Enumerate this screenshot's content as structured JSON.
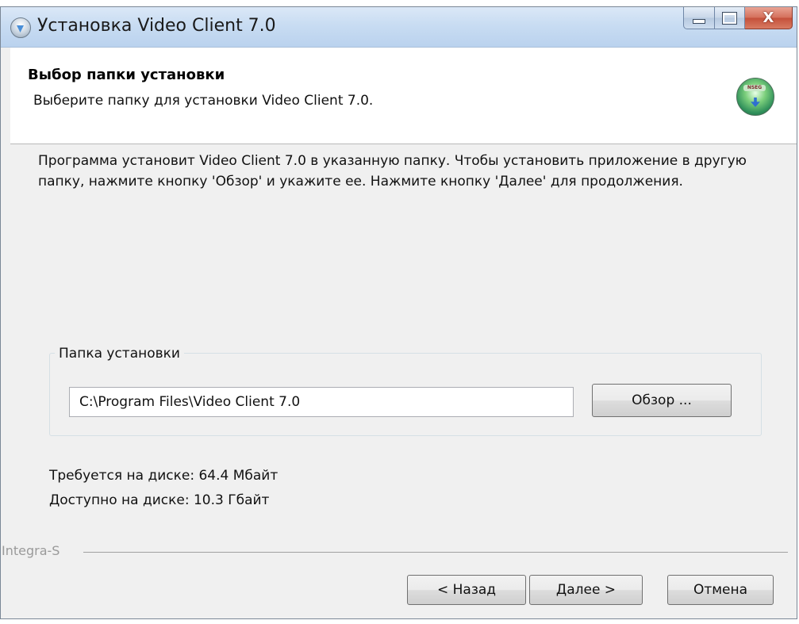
{
  "window": {
    "title": "Установка Video Client 7.0",
    "caption_buttons": {
      "minimize": "minimize-icon",
      "maximize": "maximize-icon",
      "close": "close-icon",
      "close_glyph": "X"
    }
  },
  "header": {
    "title": "Выбор папки установки",
    "subtitle": "Выберите папку для установки Video Client 7.0.",
    "logo_icon": "installer-logo-icon",
    "logo_text": "NSEG"
  },
  "body": {
    "description": "Программа установит Video Client 7.0 в указанную папку. Чтобы установить приложение в другую папку, нажмите кнопку 'Обзор' и укажите ее. Нажмите кнопку 'Далее' для продолжения."
  },
  "install_folder": {
    "legend": "Папка установки",
    "path": "C:\\Program Files\\Video Client 7.0",
    "browse_label": "Обзор ..."
  },
  "disk": {
    "required": "Требуется на диске: 64.4 Мбайт",
    "available": "Доступно на диске: 10.3 Гбайт"
  },
  "footer": {
    "brand": "Integra-S",
    "back_label": "< Назад",
    "next_label": "Далее >",
    "cancel_label": "Отмена"
  },
  "colors": {
    "titlebar": "#c8dcf2",
    "dialog_bg": "#f0f0f0",
    "header_bg": "#ffffff",
    "close_button": "#d46f5a"
  }
}
